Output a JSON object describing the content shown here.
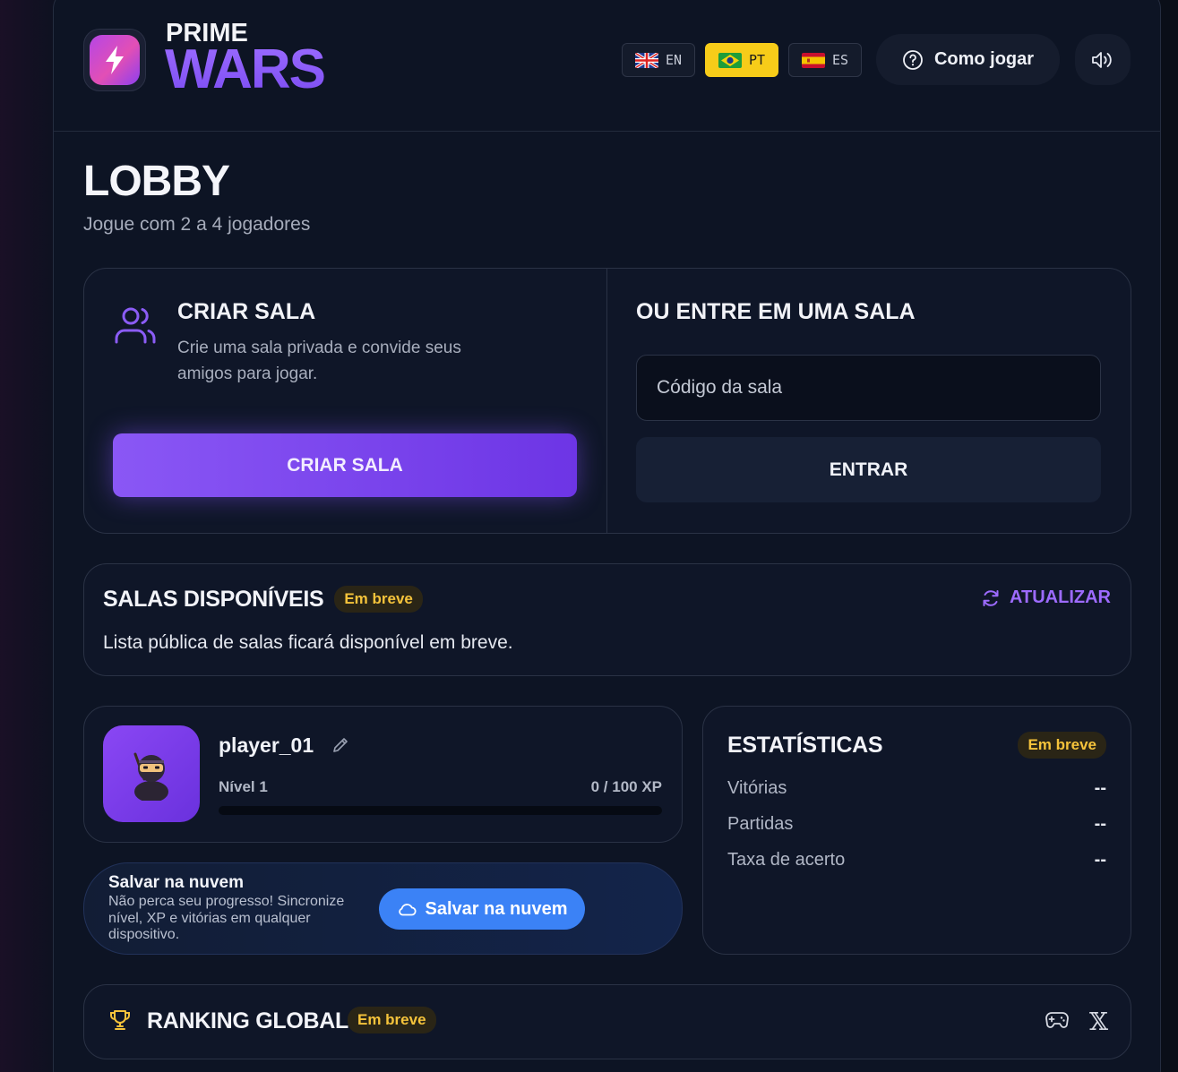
{
  "brand": {
    "top": "PRIME",
    "main": "WARS"
  },
  "languages": [
    {
      "code": "EN",
      "active": false
    },
    {
      "code": "PT",
      "active": true
    },
    {
      "code": "ES",
      "active": false
    }
  ],
  "header": {
    "help_label": "Como jogar"
  },
  "lobby": {
    "title": "LOBBY",
    "subtitle": "Jogue com 2 a 4 jogadores"
  },
  "create_room": {
    "title": "CRIAR SALA",
    "description": "Crie uma sala privada e convide seus amigos para jogar.",
    "button_label": "CRIAR SALA"
  },
  "join_room": {
    "title": "OU ENTRE EM UMA SALA",
    "input_placeholder": "Código da sala",
    "input_value": "",
    "button_label": "ENTRAR"
  },
  "available_rooms": {
    "title": "SALAS DISPONÍVEIS",
    "badge": "Em breve",
    "refresh_label": "ATUALIZAR",
    "message": "Lista pública de salas ficará disponível em breve."
  },
  "profile": {
    "name": "player_01",
    "level": "Nível 1",
    "xp": "0 / 100 XP",
    "xp_progress": 0
  },
  "cloud": {
    "title": "Salvar na nuvem",
    "description": "Não perca seu progresso! Sincronize nível, XP e vitórias em qualquer dispositivo.",
    "button_label": "Salvar na nuvem"
  },
  "stats": {
    "title": "ESTATÍSTICAS",
    "badge": "Em breve",
    "rows": [
      {
        "label": "Vitórias",
        "value": "--"
      },
      {
        "label": "Partidas",
        "value": "--"
      },
      {
        "label": "Taxa de acerto",
        "value": "--"
      }
    ]
  },
  "ranking": {
    "title": "RANKING GLOBAL",
    "badge": "Em breve",
    "x_icon_glyph": "𝕏"
  },
  "colors": {
    "accent": "#8b5cf6",
    "badge_text": "#f5c33b",
    "active_lang": "#f7cc19",
    "cloud_button": "#3b82f6"
  }
}
